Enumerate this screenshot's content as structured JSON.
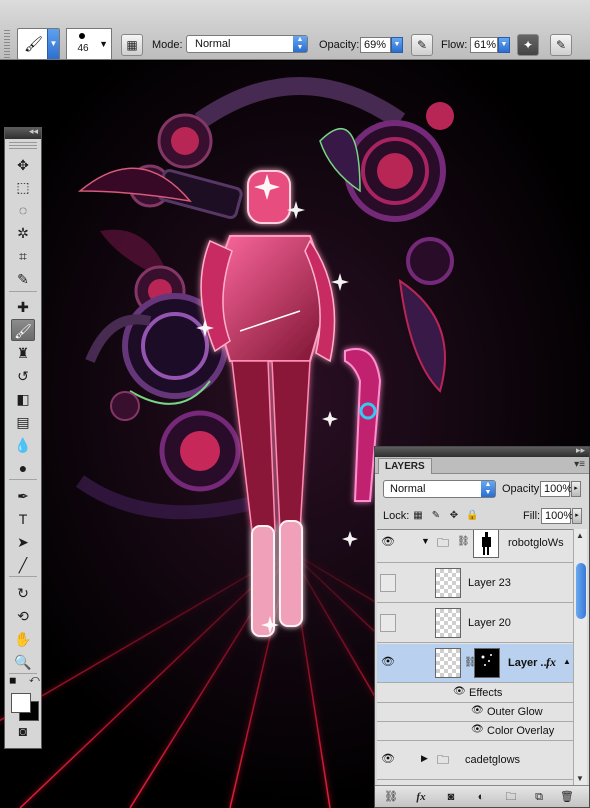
{
  "options_bar": {
    "tool_icon": "brush-icon",
    "brush_size": "46",
    "mode_label": "Mode:",
    "mode_value": "Normal",
    "opacity_label": "Opacity:",
    "opacity_value": "69%",
    "flow_label": "Flow:",
    "flow_value": "61%",
    "icons": [
      "brush-panel-icon",
      "tablet-pressure-opacity-icon",
      "airbrush-icon",
      "tablet-pressure-size-icon"
    ]
  },
  "tools": [
    {
      "name": "move-tool",
      "glyph": "✥"
    },
    {
      "name": "marquee-tool",
      "glyph": "⬚"
    },
    {
      "name": "lasso-tool",
      "glyph": "◌"
    },
    {
      "name": "magic-wand-tool",
      "glyph": "✲"
    },
    {
      "name": "crop-tool",
      "glyph": "⌗"
    },
    {
      "name": "eyedropper-tool",
      "glyph": "✎"
    },
    {
      "name": "healing-brush-tool",
      "glyph": "✚"
    },
    {
      "name": "brush-tool",
      "glyph": "🖌",
      "active": true
    },
    {
      "name": "clone-stamp-tool",
      "glyph": "♜"
    },
    {
      "name": "history-brush-tool",
      "glyph": "↺"
    },
    {
      "name": "eraser-tool",
      "glyph": "◧"
    },
    {
      "name": "gradient-tool",
      "glyph": "▤"
    },
    {
      "name": "blur-tool",
      "glyph": "💧"
    },
    {
      "name": "dodge-tool",
      "glyph": "●"
    },
    {
      "name": "pen-tool",
      "glyph": "✒"
    },
    {
      "name": "type-tool",
      "glyph": "T"
    },
    {
      "name": "path-selection-tool",
      "glyph": "➤"
    },
    {
      "name": "line-tool",
      "glyph": "╱"
    },
    {
      "name": "3d-rotate-tool",
      "glyph": "↻"
    },
    {
      "name": "3d-orbit-tool",
      "glyph": "⟲"
    },
    {
      "name": "hand-tool",
      "glyph": "✋"
    },
    {
      "name": "zoom-tool",
      "glyph": "🔍"
    },
    {
      "name": "quick-mask-button",
      "glyph": "◙"
    }
  ],
  "layers_panel": {
    "tab_label": "LAYERS",
    "blend_mode": "Normal",
    "opacity_label": "Opacity:",
    "opacity_value": "100%",
    "lock_label": "Lock:",
    "fill_label": "Fill:",
    "fill_value": "100%",
    "layers": [
      {
        "name": "robotgloWs",
        "type": "group",
        "visible": true
      },
      {
        "name": "Layer 23",
        "type": "layer",
        "visible": false
      },
      {
        "name": "Layer 20",
        "type": "layer",
        "visible": false
      },
      {
        "name": "Layer ...",
        "type": "layer",
        "visible": true,
        "selected": true,
        "has_fx": true
      },
      {
        "name": "Effects",
        "type": "effects-header"
      },
      {
        "name": "Outer Glow",
        "type": "effect"
      },
      {
        "name": "Color Overlay",
        "type": "effect"
      },
      {
        "name": "cadetglows",
        "type": "group",
        "visible": true
      }
    ],
    "bottom_icons": [
      "link-layers-icon",
      "fx-icon",
      "add-mask-icon",
      "adjustment-layer-icon",
      "new-group-icon",
      "new-layer-icon",
      "trash-icon"
    ]
  },
  "colors": {
    "glow_pink": "#ff2e7a",
    "grid_red": "#ff1f3d",
    "selection_blue": "#b9d1ee",
    "accent_blue": "#3a79d6"
  }
}
